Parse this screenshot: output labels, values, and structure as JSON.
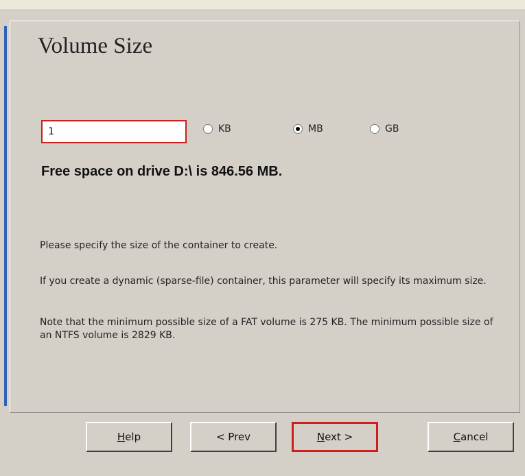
{
  "wizard": {
    "title": "Volume Size",
    "size_value": "1",
    "units": [
      {
        "label": "KB",
        "checked": false
      },
      {
        "label": "MB",
        "checked": true
      },
      {
        "label": "GB",
        "checked": false
      }
    ],
    "free_space_text": "Free space on drive D:\\ is 846.56 MB.",
    "paragraphs": [
      "Please specify the size of the container to create.",
      "If you create a dynamic (sparse-file) container, this parameter will specify its maximum size.",
      "Note that the minimum possible size of a FAT volume is 275 KB. The minimum possible size of an NTFS volume is 2829 KB."
    ]
  },
  "buttons": {
    "help": "Help",
    "prev": "< Prev",
    "next": "Next >",
    "cancel": "Cancel"
  },
  "colors": {
    "highlight": "#cc1f1f",
    "accent": "#2e63b8",
    "background": "#d4d0c8"
  }
}
